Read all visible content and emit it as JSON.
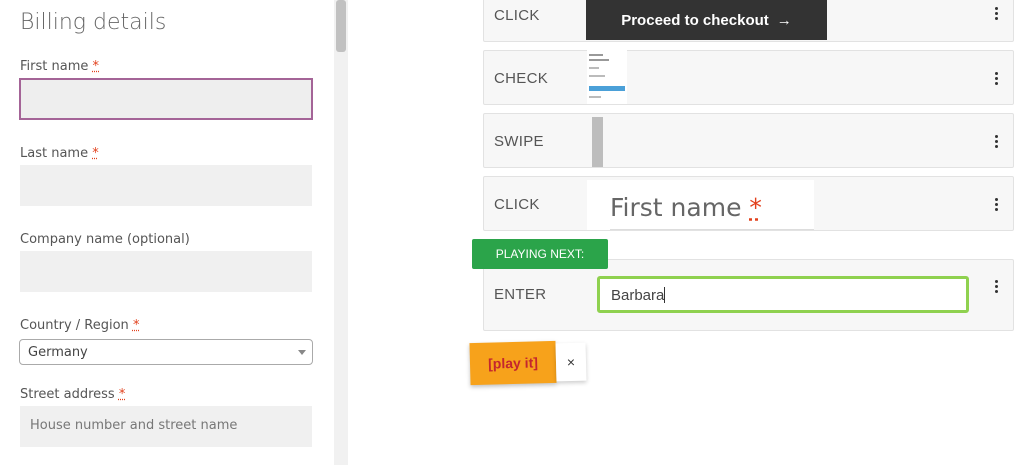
{
  "form": {
    "title": "Billing details",
    "required_mark": "*",
    "first_name_label": "First name",
    "last_name_label": "Last name",
    "company_label": "Company name (optional)",
    "country_label": "Country / Region",
    "country_value": "Germany",
    "street_label": "Street address",
    "street_placeholder": "House number and street name"
  },
  "steps": [
    {
      "action": "CLICK",
      "preview_text": "Proceed to checkout",
      "preview_icon": "arrow-right-icon"
    },
    {
      "action": "CHECK"
    },
    {
      "action": "SWIPE"
    },
    {
      "action": "CLICK",
      "preview_text": "First name",
      "preview_required": "*"
    },
    {
      "action": "ENTER",
      "value": "Barbara"
    }
  ],
  "playing_next_label": "PLAYING NEXT:",
  "play_button_label": "[play it]",
  "close_label": "×",
  "colors": {
    "accent_purple": "#a46497",
    "playing_next_green": "#2ba44a",
    "enter_border_green": "#8fd14f",
    "play_orange": "#f7a21b",
    "required_red": "#e2401c"
  }
}
